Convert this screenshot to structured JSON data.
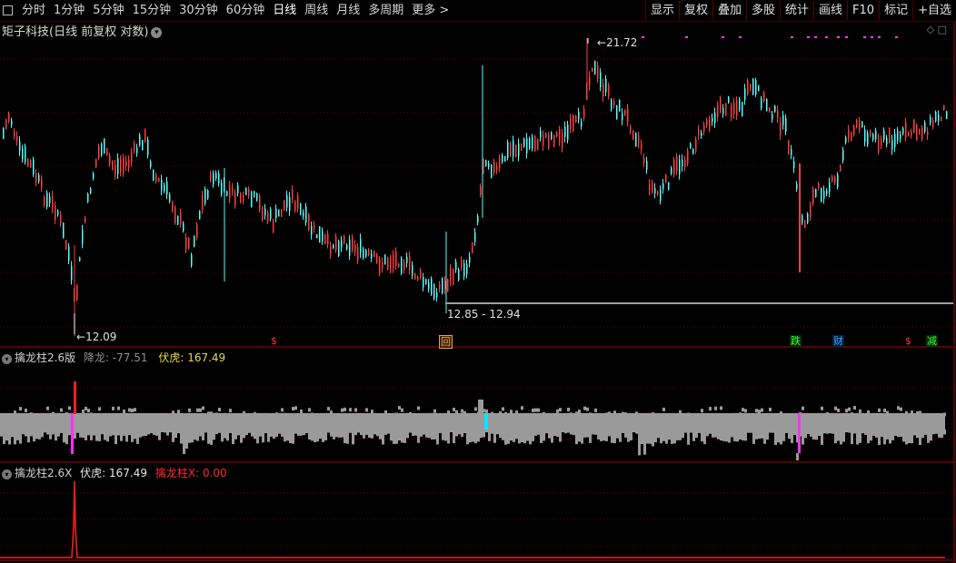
{
  "toolbar": {
    "periods": [
      {
        "label": "分时"
      },
      {
        "label": "1分钟"
      },
      {
        "label": "5分钟"
      },
      {
        "label": "15分钟"
      },
      {
        "label": "30分钟"
      },
      {
        "label": "60分钟"
      },
      {
        "label": "日线"
      },
      {
        "label": "周线"
      },
      {
        "label": "月线"
      },
      {
        "label": "多周期"
      },
      {
        "label": "更多 >"
      }
    ],
    "tools": [
      {
        "label": "显示"
      },
      {
        "label": "复权"
      },
      {
        "label": "叠加"
      },
      {
        "label": "多股"
      },
      {
        "label": "统计"
      },
      {
        "label": "画线"
      },
      {
        "label": "F10"
      },
      {
        "label": "标记"
      },
      {
        "label": "+自选"
      }
    ]
  },
  "main": {
    "title": "矩子科技(日线 前复权 对数)",
    "high_label": "21.72",
    "low_label": "12.09",
    "range_label": "12.85 - 12.94",
    "event_markers": [
      {
        "text": "$",
        "color": "#ff3030"
      },
      {
        "text": "回",
        "color": "#e0a060"
      },
      {
        "text": "跌",
        "color": "#40ff40"
      },
      {
        "text": "财",
        "color": "#40a0ff"
      },
      {
        "text": "$",
        "color": "#ff3030"
      },
      {
        "text": "减",
        "color": "#40ff40"
      }
    ],
    "colors": {
      "up": "#ff4040",
      "down": "#54ffff",
      "grid": "#7a0000",
      "border": "#b00000"
    }
  },
  "pane2": {
    "name": "擒龙柱2.6版",
    "jianglong_label": "降龙:",
    "jianglong_value": "-77.51",
    "fuhu_label": "伏虎:",
    "fuhu_value": "167.49"
  },
  "pane3": {
    "name": "擒龙柱2.6X",
    "fuhu_label": "伏虎:",
    "fuhu_value": "167.49",
    "qinlong_label": "擒龙柱X:",
    "qinlong_value": "0.00"
  }
}
